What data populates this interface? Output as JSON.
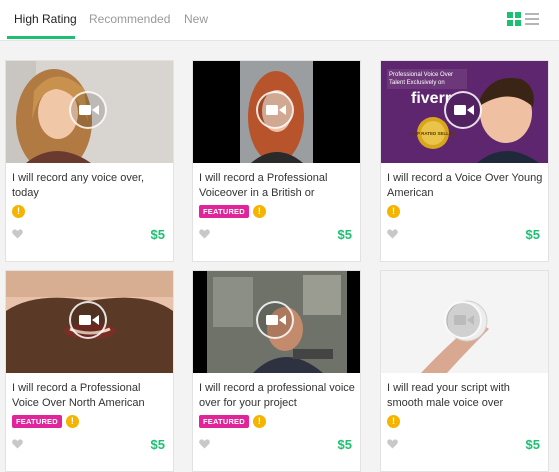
{
  "tabs": [
    {
      "label": "High Rating",
      "active": true
    },
    {
      "label": "Recommended",
      "active": false
    },
    {
      "label": "New",
      "active": false
    }
  ],
  "view_toggle": {
    "grid_icon": "grid-view-icon",
    "list_icon": "list-view-icon",
    "active": "grid"
  },
  "colors": {
    "accent": "#1dbf73",
    "featured": "#e0249a",
    "level_badge": "#f5b400"
  },
  "gigs": [
    {
      "title": "I will record any voice over, today",
      "featured": false,
      "price": "$5"
    },
    {
      "title": "I will record a Professional Voiceover in a British or",
      "featured": true,
      "featured_label": "FEATURED",
      "price": "$5"
    },
    {
      "title": "I will record a Voice Over Young American",
      "featured": false,
      "price": "$5",
      "thumb_text": {
        "line1": "Professional Voice Over",
        "line2": "Talent Exclusively on",
        "brand": "fiverr",
        "seal": "TOP RATED SELLER"
      }
    },
    {
      "title": "I will record a Professional Voice Over North American",
      "featured": true,
      "featured_label": "FEATURED",
      "price": "$5"
    },
    {
      "title": "I will record a professional voice over for your project",
      "featured": true,
      "featured_label": "FEATURED",
      "price": "$5"
    },
    {
      "title": "I will read your script with smooth male voice over",
      "featured": false,
      "price": "$5"
    }
  ],
  "level_badge_text": "!"
}
